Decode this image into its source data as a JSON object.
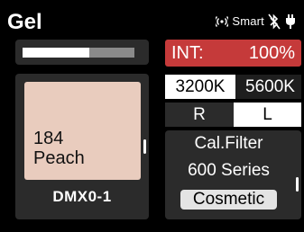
{
  "header": {
    "title": "Gel",
    "smart_label": "Smart",
    "icons": [
      "wireless-signal-icon",
      "bluetooth-slash-icon",
      "power-plug-icon"
    ]
  },
  "level_bar": {
    "value_percent": 60
  },
  "gel": {
    "number": "184",
    "name": "Peach",
    "swatch_color": "#e9ccbe",
    "dmx_label": "DMX0-1"
  },
  "intensity": {
    "label": "INT:",
    "value": "100%",
    "color": "#c53a3a"
  },
  "cct": {
    "options": [
      "3200K",
      "5600K"
    ],
    "selected": "3200K"
  },
  "side": {
    "options": [
      "R",
      "L"
    ],
    "selected": "L"
  },
  "filter": {
    "line1": "Cal.Filter",
    "line2": "600 Series",
    "selected": "Cosmetic"
  }
}
